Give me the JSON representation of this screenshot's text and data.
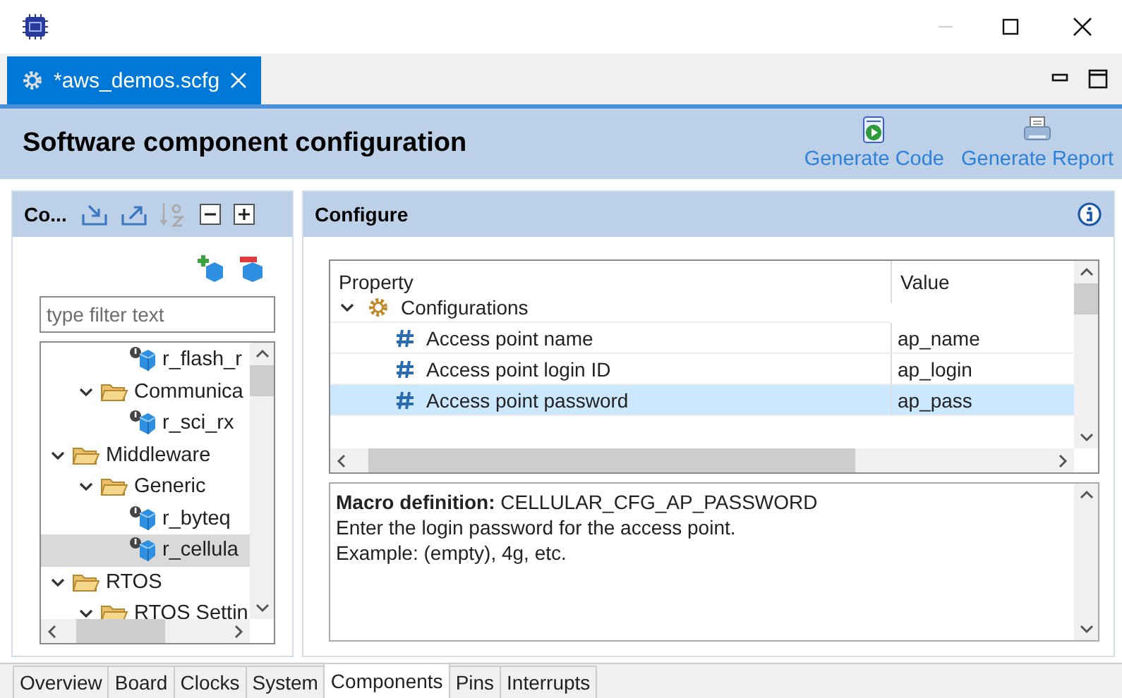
{
  "editor_tab": {
    "label": "*aws_demos.scfg",
    "selected": true
  },
  "header": {
    "title": "Software component configuration",
    "actions": [
      {
        "kind": "code",
        "label": "Generate Code"
      },
      {
        "kind": "report",
        "label": "Generate Report"
      }
    ]
  },
  "components_panel": {
    "title": "Co...",
    "filter": {
      "placeholder": "type filter text"
    },
    "tree": [
      {
        "children": [
          {
            "children": [
              {
                "kind": "component",
                "label": "r_flash_r",
                "selected": false
              }
            ]
          },
          {
            "kind": "folder",
            "label": "Communica",
            "expanded": true,
            "selected": false,
            "children": [
              {
                "kind": "component",
                "label": "r_sci_rx",
                "selected": false
              }
            ]
          }
        ]
      },
      {
        "kind": "folder",
        "label": "Middleware",
        "expanded": true,
        "selected": false,
        "children": [
          {
            "kind": "folder",
            "label": "Generic",
            "expanded": true,
            "selected": false,
            "children": [
              {
                "kind": "component",
                "label": "r_byteq",
                "selected": false
              },
              {
                "kind": "component",
                "label": "r_cellula",
                "selected": true
              }
            ]
          }
        ]
      },
      {
        "kind": "folder",
        "label": "RTOS",
        "expanded": true,
        "selected": false,
        "children": [
          {
            "kind": "folder",
            "label": "RTOS Settin",
            "expanded": true,
            "selected": false
          }
        ]
      }
    ]
  },
  "configure_panel": {
    "title": "Configure",
    "table": {
      "columns": [
        "Property",
        "Value"
      ],
      "rows": [
        {
          "kind": "group",
          "label": "Configurations",
          "expanded": true,
          "children": [
            {
              "kind": "property",
              "label": "Access point name",
              "value": "ap_name",
              "selected": false
            },
            {
              "kind": "property",
              "label": "Access point login ID",
              "value": "ap_login",
              "selected": false
            },
            {
              "kind": "property",
              "label": "Access point password",
              "value": "ap_pass",
              "selected": true
            }
          ]
        }
      ]
    },
    "description": [
      "**Macro definition:** CELLULAR_CFG_AP_PASSWORD",
      "Enter the login password for the access point.",
      "Example: (empty), 4g, etc."
    ]
  },
  "page_tabs": [
    {
      "label": "Overview",
      "selected": false
    },
    {
      "label": "Board",
      "selected": false
    },
    {
      "label": "Clocks",
      "selected": false
    },
    {
      "label": "System",
      "selected": false
    },
    {
      "label": "Components",
      "selected": true
    },
    {
      "label": "Pins",
      "selected": false
    },
    {
      "label": "Interrupts",
      "selected": false
    }
  ]
}
